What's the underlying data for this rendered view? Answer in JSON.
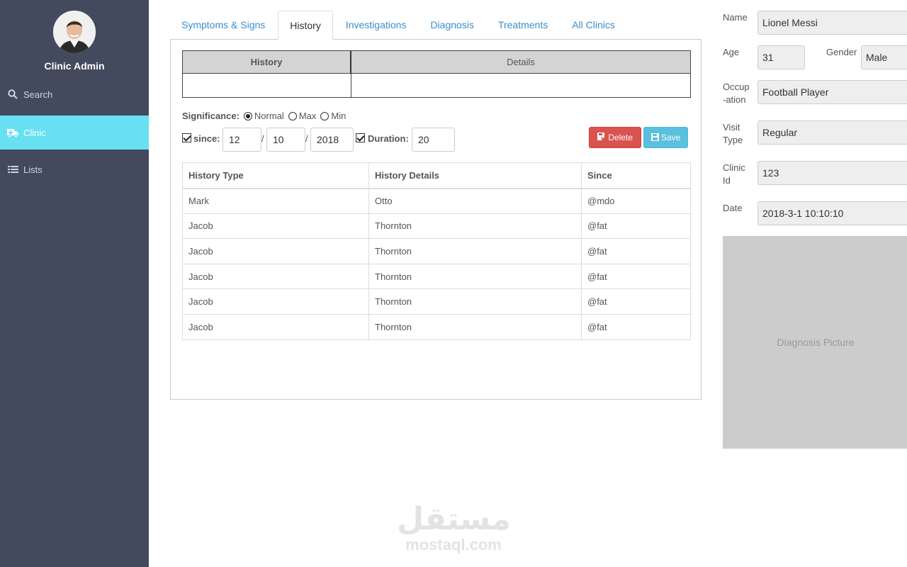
{
  "sidebar": {
    "title": "Clinic Admin",
    "items": [
      {
        "label": "Search",
        "icon": "search-icon"
      },
      {
        "label": "Clinic",
        "icon": "ambulance-icon",
        "active": true
      },
      {
        "label": "Lists",
        "icon": "list-icon"
      }
    ]
  },
  "tabs": [
    "Symptoms & Signs",
    "History",
    "Investigations",
    "Diagnosis",
    "Treatments",
    "All Clinics"
  ],
  "active_tab": "History",
  "history_header": {
    "col1": "History",
    "col2": "Details"
  },
  "significance": {
    "label": "Significance:",
    "options": [
      "Normal",
      "Max",
      "Min"
    ],
    "selected": "Normal"
  },
  "since": {
    "label": "since:",
    "day": "12",
    "month": "10",
    "year": "2018",
    "separator": "/"
  },
  "duration": {
    "label": "Duration:",
    "value": "20"
  },
  "buttons": {
    "delete": "Delete",
    "save": "Save"
  },
  "table": {
    "headers": [
      "History Type",
      "History Details",
      "Since"
    ],
    "rows": [
      [
        "Mark",
        "Otto",
        "@mdo"
      ],
      [
        "Jacob",
        "Thornton",
        "@fat"
      ],
      [
        "Jacob",
        "Thornton",
        "@fat"
      ],
      [
        "Jacob",
        "Thornton",
        "@fat"
      ],
      [
        "Jacob",
        "Thornton",
        "@fat"
      ],
      [
        "Jacob",
        "Thornton",
        "@fat"
      ]
    ]
  },
  "patient": {
    "name_label": "Name",
    "name": "Lionel Messi",
    "age_label": "Age",
    "age": "31",
    "gender_label": "Gender",
    "gender": "Male",
    "occupation_label_1": "Occup",
    "occupation_label_2": "-ation",
    "occupation": "Football Player",
    "visit_label_1": "Visit",
    "visit_label_2": "Type",
    "visit_type": "Regular",
    "clinic_label_1": "Clinic",
    "clinic_label_2": "Id",
    "clinic_id": "123",
    "date_label": "Date",
    "date": "2018-3-1 10:10:10"
  },
  "diagnosis_picture": "Diagnosis Picture",
  "watermark": {
    "arabic": "مستقل",
    "latin": "mostaql.com"
  },
  "colors": {
    "sidebar": "#434a5e",
    "active": "#67e0f3",
    "link": "#3a8ecb",
    "danger": "#d9534f",
    "info": "#5bc0de"
  }
}
